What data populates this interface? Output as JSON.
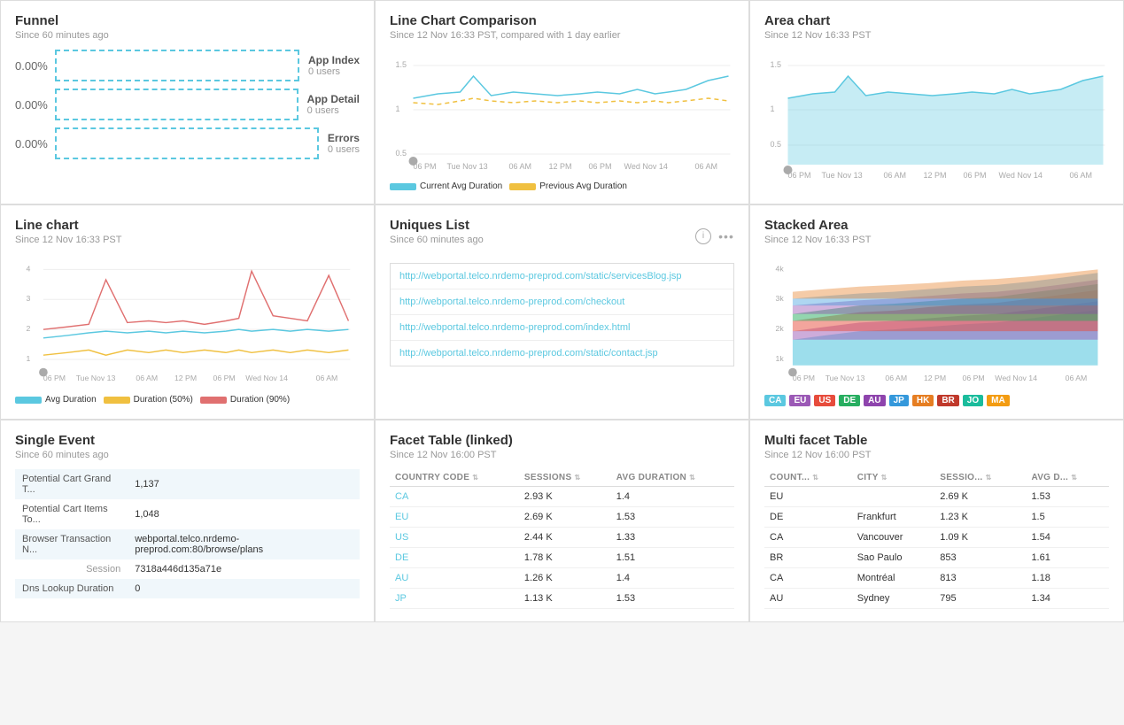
{
  "funnel": {
    "title": "Funnel",
    "subtitle": "Since 60 minutes ago",
    "bars": [
      {
        "pct": "0.00%",
        "label": "App Index",
        "users": "0 users"
      },
      {
        "pct": "0.00%",
        "label": "App Detail",
        "users": "0 users"
      },
      {
        "pct": "0.00%",
        "label": "Errors",
        "users": "0 users"
      }
    ]
  },
  "lineComparison": {
    "title": "Line Chart Comparison",
    "subtitle": "Since 12 Nov 16:33 PST, compared with 1 day earlier",
    "yLabels": [
      "0.5",
      "1",
      "1.5"
    ],
    "xLabels": [
      "06 PM",
      "Tue Nov 13",
      "06 AM",
      "12 PM",
      "06 PM",
      "Wed Nov 14",
      "06 AM"
    ],
    "legend": [
      {
        "label": "Current Avg Duration",
        "color": "#5bc8e0"
      },
      {
        "label": "Previous Avg Duration",
        "color": "#f0c040",
        "dashed": true
      }
    ]
  },
  "areaChart": {
    "title": "Area chart",
    "subtitle": "Since 12 Nov 16:33 PST",
    "yLabels": [
      "0.5",
      "1",
      "1.5"
    ],
    "xLabels": [
      "06 PM",
      "Tue Nov 13",
      "06 AM",
      "12 PM",
      "06 PM",
      "Wed Nov 14",
      "06 AM"
    ]
  },
  "lineChart": {
    "title": "Line chart",
    "subtitle": "Since 12 Nov 16:33 PST",
    "yLabels": [
      "1",
      "2",
      "3",
      "4"
    ],
    "xLabels": [
      "06 PM",
      "Tue Nov 13",
      "06 AM",
      "12 PM",
      "06 PM",
      "Wed Nov 14",
      "06 AM"
    ],
    "legend": [
      {
        "label": "Avg Duration",
        "color": "#5bc8e0"
      },
      {
        "label": "Duration (50%)",
        "color": "#f0c040"
      },
      {
        "label": "Duration (90%)",
        "color": "#e07070"
      }
    ]
  },
  "uniquesList": {
    "title": "Uniques List",
    "subtitle": "Since 60 minutes ago",
    "items": [
      "http://webportal.telco.nrdemo-preprod.com/static/servicesBlog.jsp",
      "http://webportal.telco.nrdemo-preprod.com/checkout",
      "http://webportal.telco.nrdemo-preprod.com/index.html",
      "http://webportal.telco.nrdemo-preprod.com/static/contact.jsp"
    ]
  },
  "stackedArea": {
    "title": "Stacked Area",
    "subtitle": "Since 12 Nov 16:33 PST",
    "yLabels": [
      "1k",
      "2k",
      "3k",
      "4k"
    ],
    "xLabels": [
      "06 PM",
      "Tue Nov 13",
      "06 AM",
      "12 PM",
      "06 PM",
      "Wed Nov 14",
      "06 AM"
    ],
    "badges": [
      {
        "label": "CA",
        "color": "#5bc8e0"
      },
      {
        "label": "EU",
        "color": "#9b59b6"
      },
      {
        "label": "US",
        "color": "#e74c3c"
      },
      {
        "label": "DE",
        "color": "#27ae60"
      },
      {
        "label": "AU",
        "color": "#8e44ad"
      },
      {
        "label": "JP",
        "color": "#3498db"
      },
      {
        "label": "HK",
        "color": "#e67e22"
      },
      {
        "label": "BR",
        "color": "#c0392b"
      },
      {
        "label": "JO",
        "color": "#1abc9c"
      },
      {
        "label": "MA",
        "color": "#f39c12"
      }
    ]
  },
  "singleEvent": {
    "title": "Single Event",
    "subtitle": "Since 60 minutes ago",
    "rows": [
      {
        "key": "Potential Cart Grand T...",
        "value": "1,137"
      },
      {
        "key": "Potential Cart Items To...",
        "value": "1,048"
      },
      {
        "key": "Browser Transaction N...",
        "value": "webportal.telco.nrdemo-preprod.com:80/browse/plans"
      },
      {
        "key": "Session",
        "value": "7318a446d135a71e"
      },
      {
        "key": "Dns Lookup Duration",
        "value": "0"
      }
    ]
  },
  "facetTable": {
    "title": "Facet Table (linked)",
    "subtitle": "Since 12 Nov 16:00 PST",
    "columns": [
      "COUNTRY CODE",
      "SESSIONS",
      "AVG DURATION"
    ],
    "rows": [
      {
        "code": "CA",
        "sessions": "2.93 K",
        "avgDuration": "1.4"
      },
      {
        "code": "EU",
        "sessions": "2.69 K",
        "avgDuration": "1.53"
      },
      {
        "code": "US",
        "sessions": "2.44 K",
        "avgDuration": "1.33"
      },
      {
        "code": "DE",
        "sessions": "1.78 K",
        "avgDuration": "1.51"
      },
      {
        "code": "AU",
        "sessions": "1.26 K",
        "avgDuration": "1.4"
      },
      {
        "code": "JP",
        "sessions": "1.13 K",
        "avgDuration": "1.53"
      }
    ]
  },
  "multiFacetTable": {
    "title": "Multi facet Table",
    "subtitle": "Since 12 Nov 16:00 PST",
    "columns": [
      "COUNT...",
      "CITY",
      "SESSIO...",
      "AVG D..."
    ],
    "rows": [
      {
        "count": "EU",
        "city": "",
        "sessions": "2.69 K",
        "avgDuration": "1.53"
      },
      {
        "count": "DE",
        "city": "Frankfurt",
        "sessions": "1.23 K",
        "avgDuration": "1.5"
      },
      {
        "count": "CA",
        "city": "Vancouver",
        "sessions": "1.09 K",
        "avgDuration": "1.54"
      },
      {
        "count": "BR",
        "city": "Sao Paulo",
        "sessions": "853",
        "avgDuration": "1.61"
      },
      {
        "count": "CA",
        "city": "Montréal",
        "sessions": "813",
        "avgDuration": "1.18"
      },
      {
        "count": "AU",
        "city": "Sydney",
        "sessions": "795",
        "avgDuration": "1.34"
      }
    ]
  }
}
